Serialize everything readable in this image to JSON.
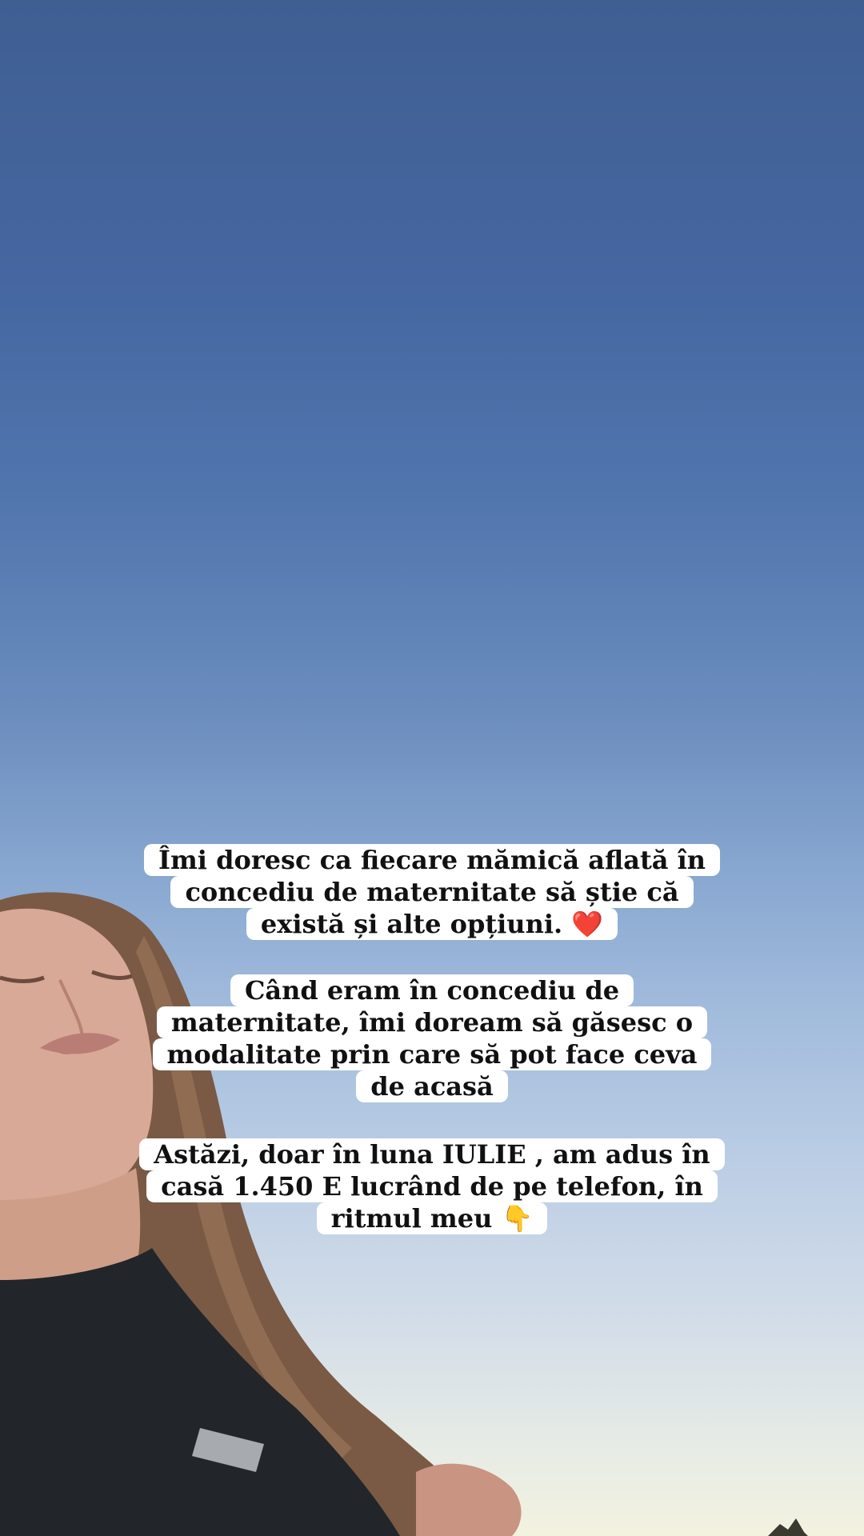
{
  "background": {
    "sky_top_color": "#3f5f93",
    "sky_bottom_color": "#f3f2e0",
    "subject": "woman-with-closed-eyes-photo"
  },
  "captions": [
    {
      "lines": [
        "Îmi doresc ca fiecare mămică aflată în",
        "concediu de maternitate să știe că",
        "există și alte opțiuni. ❤️"
      ]
    },
    {
      "lines": [
        "Când eram în concediu de",
        "maternitate, îmi doream să găsesc o",
        "modalitate prin care să pot face ceva",
        "de acasă"
      ]
    },
    {
      "lines": [
        "Astăzi, doar în luna IULIE , am adus în",
        "casă  1.450 E lucrând de pe telefon, în",
        "ritmul meu 👇"
      ]
    }
  ]
}
